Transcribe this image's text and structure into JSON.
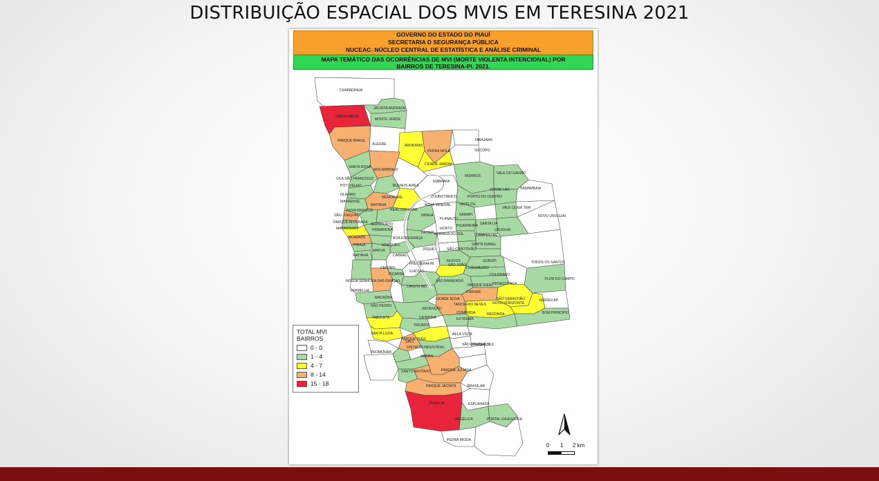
{
  "slide_title": "DISTRIBUIÇÃO ESPACIAL DOS MVIS EM TERESINA 2021",
  "header": {
    "line1": "GOVERNO DO ESTADO DO PIAUÍ",
    "line2": "SECRETARIA D SEGURANÇA PÚBLICA",
    "line3": "NUCEAC- NÚCLEO CENTRAL DE ESTATÍSTICA E ANÁLISE CRIMINAL",
    "line4": "MAPA TEMÁTICO DAS OCORRÊNCIAS DE MVI (MORTE VIOLENTA INTENCIONAL) POR",
    "line5": "BAIRROS DE TERESINA-PI. 2021."
  },
  "colors": {
    "c0": "#ffffff",
    "c1": "#a6daa2",
    "c2": "#ffff33",
    "c3": "#f6b170",
    "c4": "#e8253b",
    "footer": "#7b0f0f"
  },
  "legend": {
    "title": "TOTAL MVI BAIRROS",
    "items": [
      {
        "label": "0 - 0",
        "color": "#ffffff"
      },
      {
        "label": "1 - 4",
        "color": "#a6daa2"
      },
      {
        "label": "4 - 7",
        "color": "#ffff33"
      },
      {
        "label": "8 - 14",
        "color": "#f6b170"
      },
      {
        "label": "15 - 18",
        "color": "#e8253b"
      }
    ]
  },
  "scale": {
    "zero": "0",
    "one": "1",
    "two": "2 km"
  },
  "north_arrow": "north-arrow-icon",
  "neighborhoods": [
    {
      "name": "CHAPADINHA",
      "class": 0
    },
    {
      "name": "JACINTA ANDRADE",
      "class": 1
    },
    {
      "name": "SANTA MARIA",
      "class": 4
    },
    {
      "name": "MONTE VERDE",
      "class": 1
    },
    {
      "name": "PARQUE BRASIL",
      "class": 3
    },
    {
      "name": "ALEGRE",
      "class": 0
    },
    {
      "name": "AROEIRAS",
      "class": 2
    },
    {
      "name": "PEDRA MOLE",
      "class": 3
    },
    {
      "name": "TABAJARA",
      "class": 0
    },
    {
      "name": "SOCOPO",
      "class": 0
    },
    {
      "name": "CIDADE JARDIM",
      "class": 2
    },
    {
      "name": "SANTA ROSA",
      "class": 1
    },
    {
      "name": "MOCAMBINHO",
      "class": 3
    },
    {
      "name": "VILA SÃO FRANCISCO",
      "class": 1
    },
    {
      "name": "EMBRAPA",
      "class": 0
    },
    {
      "name": "BUENOS AIRES",
      "class": 1
    },
    {
      "name": "MORROS",
      "class": 1
    },
    {
      "name": "VALE DO GAVIÃO",
      "class": 1
    },
    {
      "name": "POTI VELHO",
      "class": 1
    },
    {
      "name": "OLARIAS",
      "class": 1
    },
    {
      "name": "MAFRENSE",
      "class": 1
    },
    {
      "name": "MEMORARE",
      "class": 3
    },
    {
      "name": "VERDE LAR",
      "class": 1
    },
    {
      "name": "SAMAMBAIA",
      "class": 0
    },
    {
      "name": "ZOOBOTÂNICO",
      "class": 0
    },
    {
      "name": "PORTO DO CENTRO",
      "class": 1
    },
    {
      "name": "ÁGUA MINERAL",
      "class": 2
    },
    {
      "name": "MATINHA",
      "class": 1
    },
    {
      "name": "REAL COPAGRE",
      "class": 1
    },
    {
      "name": "SATÉLITE",
      "class": 1
    },
    {
      "name": "VALE QUEM TEM",
      "class": 1
    },
    {
      "name": "NOVA BRASÍLIA",
      "class": 3
    },
    {
      "name": "SÃO JOAQUIM",
      "class": 1
    },
    {
      "name": "ININGA",
      "class": 1
    },
    {
      "name": "SAMAPI",
      "class": 1
    },
    {
      "name": "NOVO URUGUAI",
      "class": 0
    },
    {
      "name": "PARQUE ALVORADA",
      "class": 2
    },
    {
      "name": "PLANALTO",
      "class": 0
    },
    {
      "name": "PIÇARREIRA",
      "class": 1
    },
    {
      "name": "SANTA LIA",
      "class": 1
    },
    {
      "name": "AEROPORTO",
      "class": 1
    },
    {
      "name": "URUGUAI",
      "class": 1
    },
    {
      "name": "MATADOURO",
      "class": 3
    },
    {
      "name": "PRIMAVERA",
      "class": 1
    },
    {
      "name": "FÁTIMA",
      "class": 1
    },
    {
      "name": "HORTO",
      "class": 0
    },
    {
      "name": "MORADA DO SOL",
      "class": 0
    },
    {
      "name": "CAMPESTRE",
      "class": 1
    },
    {
      "name": "ACARAPE",
      "class": 1
    },
    {
      "name": "BOA ESPERANÇA",
      "class": 1
    },
    {
      "name": "PIRAJÁ",
      "class": 1
    },
    {
      "name": "MARQUES",
      "class": 1
    },
    {
      "name": "SANTA ISABEL",
      "class": 1
    },
    {
      "name": "MAFUÁ",
      "class": 0
    },
    {
      "name": "JÓQUEI",
      "class": 0
    },
    {
      "name": "SÃO CRISTÓVÃO",
      "class": 1
    },
    {
      "name": "MATINHA",
      "class": 1
    },
    {
      "name": "CABRAL",
      "class": 0
    },
    {
      "name": "NOIVOS",
      "class": 0
    },
    {
      "name": "TODOS OS SANTOS",
      "class": 0
    },
    {
      "name": "GURUPI",
      "class": 1
    },
    {
      "name": "CENTRO",
      "class": 3
    },
    {
      "name": "FREI SERAFIM",
      "class": 0
    },
    {
      "name": "SÃO JOÃO",
      "class": 2
    },
    {
      "name": "LIVRAMENTO",
      "class": 1
    },
    {
      "name": "PIÇARRA",
      "class": 1
    },
    {
      "name": "ILHOTAS",
      "class": 1
    },
    {
      "name": "COLORADO",
      "class": 1
    },
    {
      "name": "FLOR DO CAMPO",
      "class": 1
    },
    {
      "name": "NOSSA SENHORA DAS GRAÇAS",
      "class": 0
    },
    {
      "name": "SÃO RAIMUNDO",
      "class": 1
    },
    {
      "name": "PARQUE IDEAL",
      "class": 3
    },
    {
      "name": "RENASCENÇA",
      "class": 2
    },
    {
      "name": "CRISTO REI",
      "class": 1
    },
    {
      "name": "VERMELHA",
      "class": 1
    },
    {
      "name": "ITARARÉ",
      "class": 3
    },
    {
      "name": "SÃO SEBASTIÃO",
      "class": 2
    },
    {
      "name": "VERDECAP",
      "class": 0
    },
    {
      "name": "MACAÚBA",
      "class": 1
    },
    {
      "name": "CIDADE NOVA",
      "class": 1
    },
    {
      "name": "NOVO HORIZONTE",
      "class": 2
    },
    {
      "name": "TANCREDO NEVES",
      "class": 1
    },
    {
      "name": "SÃO PEDRO",
      "class": 2
    },
    {
      "name": "REDENÇÃO",
      "class": 1
    },
    {
      "name": "REDONDA",
      "class": 1
    },
    {
      "name": "BOM PRINCÍPIO",
      "class": 1
    },
    {
      "name": "TABULETA",
      "class": 2
    },
    {
      "name": "CATARINA",
      "class": 2
    },
    {
      "name": "COMPRIDA",
      "class": 0
    },
    {
      "name": "EXTREMA",
      "class": 0
    },
    {
      "name": "TRIUNFO",
      "class": 3
    },
    {
      "name": "SANTA LUZIA",
      "class": 0
    },
    {
      "name": "BELA VISTA",
      "class": 1
    },
    {
      "name": "SACI",
      "class": 1
    },
    {
      "name": "SÃO LOURENÇO",
      "class": 0
    },
    {
      "name": "PARQUE PIAUÍ",
      "class": 1
    },
    {
      "name": "PARQUE SUL",
      "class": 0
    },
    {
      "name": "DISTRITO INDUSTRIAL",
      "class": 0
    },
    {
      "name": "PROMORAR",
      "class": 3
    },
    {
      "name": "AREIAS",
      "class": 1
    },
    {
      "name": "SANTO ANTÔNIO",
      "class": 3
    },
    {
      "name": "PARQUE JULIANA",
      "class": 0
    },
    {
      "name": "PARQUE JACINTA",
      "class": 3
    },
    {
      "name": "BRASILAR",
      "class": 0
    },
    {
      "name": "ANGELIM",
      "class": 4
    },
    {
      "name": "ESPLANADA",
      "class": 1
    },
    {
      "name": "PORTAL DA ALEGRIA",
      "class": 1
    },
    {
      "name": "ANGÉLICA",
      "class": 0
    },
    {
      "name": "PEDRA MIÚDA",
      "class": 0
    }
  ]
}
